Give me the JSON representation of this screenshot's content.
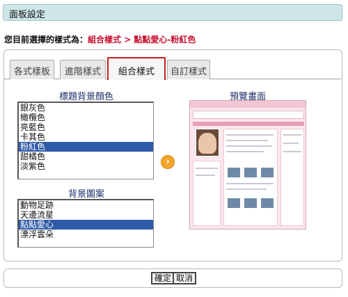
{
  "header": {
    "title": "面板設定"
  },
  "current": {
    "label": "您目前選擇的樣式為：",
    "value": "組合樣式 > 點點愛心-粉紅色"
  },
  "tabs": [
    {
      "label": "各式樣板"
    },
    {
      "label": "進階樣式"
    },
    {
      "label": "組合樣式"
    },
    {
      "label": "自訂樣式"
    }
  ],
  "title_bg": {
    "heading": "標題背景顏色",
    "options": [
      "銀灰色",
      "橄欖色",
      "亮藍色",
      "卡其色",
      "粉紅色",
      "甜橘色",
      "淡紫色"
    ],
    "selected": "粉紅色"
  },
  "bg_image": {
    "heading": "背景圖案",
    "options": [
      "動物足跡",
      "天邊流星",
      "點點愛心",
      "漂浮雲朵"
    ],
    "selected": "點點愛心"
  },
  "preview": {
    "heading": "預覽畫面"
  },
  "buttons": {
    "ok": "確定",
    "cancel": "取消"
  },
  "colors": {
    "accent_selected": "#2f5ba8",
    "current_value": "#c8102e",
    "header_bg": "#cfe6e8"
  }
}
